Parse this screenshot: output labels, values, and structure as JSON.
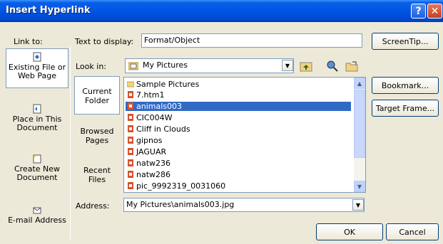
{
  "window": {
    "title": "Insert Hyperlink",
    "help_glyph": "?",
    "close_glyph": "✕"
  },
  "link_to": {
    "label": "Link to:",
    "items": [
      {
        "label_line1": "Existing File or",
        "label_line2": "Web Page",
        "selected": true,
        "icon": "file-icon"
      },
      {
        "label_line1": "Place in This",
        "label_line2": "Document",
        "selected": false,
        "icon": "document-place-icon"
      },
      {
        "label_line1": "Create New",
        "label_line2": "Document",
        "selected": false,
        "icon": "new-document-icon"
      },
      {
        "label_line1": "E-mail Address",
        "label_line2": "",
        "selected": false,
        "icon": "email-icon"
      }
    ]
  },
  "text_to_display": {
    "label": "Text to display:",
    "value": "Format/Object"
  },
  "screentip_button": "ScreenTip...",
  "look_in": {
    "label": "Look in:",
    "value": "My Pictures"
  },
  "sub_nav": [
    {
      "line1": "Current",
      "line2": "Folder",
      "selected": true
    },
    {
      "line1": "Browsed",
      "line2": "Pages",
      "selected": false
    },
    {
      "line1": "Recent",
      "line2": "Files",
      "selected": false
    }
  ],
  "files": [
    {
      "name": "Sample Pictures",
      "icon": "folder-icon",
      "selected": false
    },
    {
      "name": "7.htm1",
      "icon": "html-file-icon",
      "selected": false
    },
    {
      "name": "animals003",
      "icon": "image-file-icon",
      "selected": true
    },
    {
      "name": "CIC004W",
      "icon": "image-file-icon",
      "selected": false
    },
    {
      "name": "Cliff in Clouds",
      "icon": "image-file-icon",
      "selected": false
    },
    {
      "name": "gipnos",
      "icon": "image-file-icon",
      "selected": false
    },
    {
      "name": "JAGUAR",
      "icon": "image-file-icon",
      "selected": false
    },
    {
      "name": "natw236",
      "icon": "image-file-icon",
      "selected": false
    },
    {
      "name": "natw286",
      "icon": "image-file-icon",
      "selected": false
    },
    {
      "name": "pic_9992319_0031060",
      "icon": "image-file-icon",
      "selected": false
    }
  ],
  "side_buttons": {
    "bookmark": "Bookmark...",
    "target_frame": "Target Frame..."
  },
  "address": {
    "label": "Address:",
    "value": "My Pictures\\animals003.jpg"
  },
  "footer": {
    "ok": "OK",
    "cancel": "Cancel"
  },
  "colors": {
    "titlebar": "#0055e5",
    "dialog_bg": "#ece9d8",
    "selection": "#316ac5"
  }
}
